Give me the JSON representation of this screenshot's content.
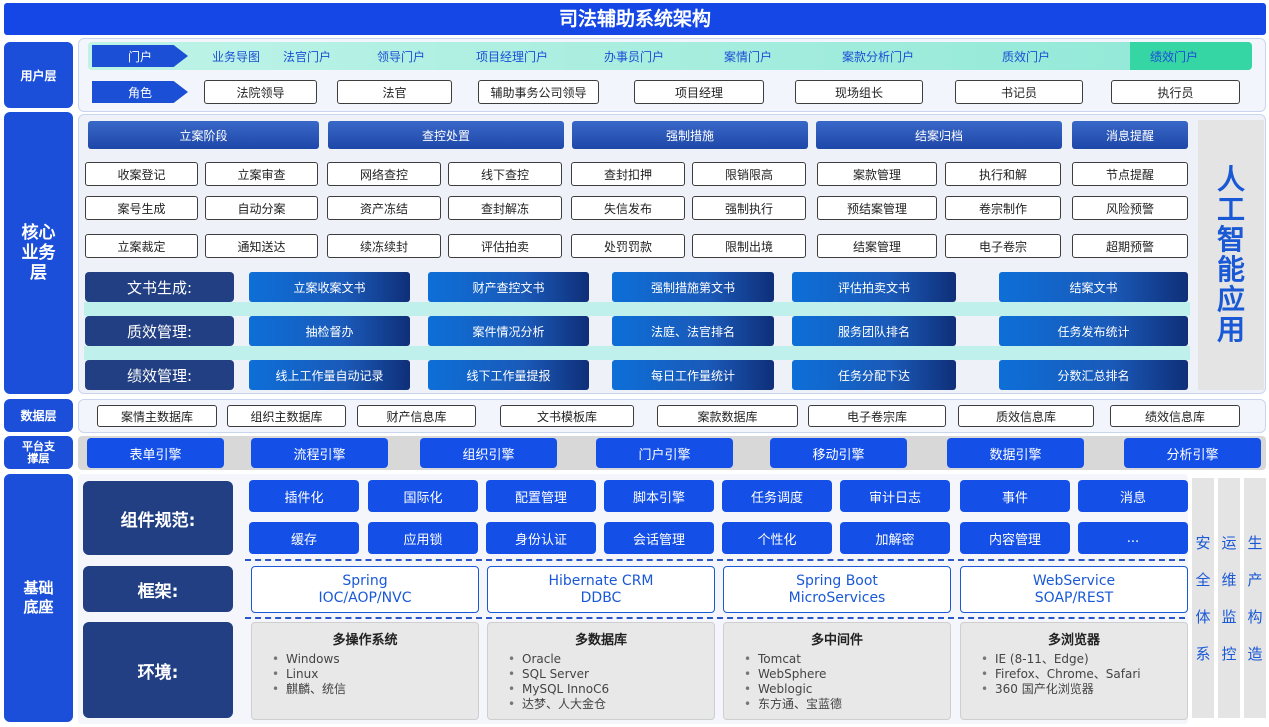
{
  "title": "司法辅助系统架构",
  "layers": {
    "user": "用户层",
    "core": "核心业务层",
    "data": "数据层",
    "platform": "平台支撑层",
    "base": "基础底座"
  },
  "portal": {
    "tag": "门户",
    "items": [
      "业务导图",
      "法官门户",
      "领导门户",
      "项目经理门户",
      "办事员门户",
      "案情门户",
      "案款分析门户",
      "质效门户",
      "绩效门户"
    ]
  },
  "roles": {
    "tag": "角色",
    "items": [
      "法院领导",
      "法官",
      "辅助事务公司领导",
      "项目经理",
      "现场组长",
      "书记员",
      "执行员"
    ]
  },
  "stages": [
    "立案阶段",
    "查控处置",
    "强制措施",
    "结案归档",
    "消息提醒"
  ],
  "business_rows": [
    [
      "收案登记",
      "立案审查",
      "网络查控",
      "线下查控",
      "查封扣押",
      "限销限高",
      "案款管理",
      "执行和解",
      "节点提醒"
    ],
    [
      "案号生成",
      "自动分案",
      "资产冻结",
      "查封解冻",
      "失信发布",
      "强制执行",
      "预结案管理",
      "卷宗制作",
      "风险预警"
    ],
    [
      "立案裁定",
      "通知送达",
      "续冻续封",
      "评估拍卖",
      "处罚罚款",
      "限制出境",
      "结案管理",
      "电子卷宗",
      "超期预警"
    ]
  ],
  "doc_gen": {
    "label": "文书生成:",
    "items": [
      "立案收案文书",
      "财产查控文书",
      "强制措施第文书",
      "评估拍卖文书",
      "结案文书"
    ]
  },
  "quality": {
    "label": "质效管理:",
    "items": [
      "抽检督办",
      "案件情况分析",
      "法庭、法官排名",
      "服务团队排名",
      "任务发布统计"
    ]
  },
  "performance": {
    "label": "绩效管理:",
    "items": [
      "线上工作量自动记录",
      "线下工作量提报",
      "每日工作量统计",
      "任务分配下达",
      "分数汇总排名"
    ]
  },
  "ai": [
    "人",
    "工",
    "智",
    "能",
    "应",
    "用"
  ],
  "data_items": [
    "案情主数据库",
    "组织主数据库",
    "财产信息库",
    "文书模板库",
    "案款数据库",
    "电子卷宗库",
    "质效信息库",
    "绩效信息库"
  ],
  "engines": [
    "表单引擎",
    "流程引擎",
    "组织引擎",
    "门户引擎",
    "移动引擎",
    "数据引擎",
    "分析引擎"
  ],
  "components": {
    "label": "组件规范:",
    "row1": [
      "插件化",
      "国际化",
      "配置管理",
      "脚本引擎",
      "任务调度",
      "审计日志",
      "事件",
      "消息"
    ],
    "row2": [
      "缓存",
      "应用锁",
      "身份认证",
      "会话管理",
      "个性化",
      "加解密",
      "内容管理",
      "..."
    ]
  },
  "framework": {
    "label": "框架:",
    "items": [
      {
        "l1": "Spring",
        "l2": "IOC/AOP/NVC"
      },
      {
        "l1": "Hibernate CRM",
        "l2": "DDBC"
      },
      {
        "l1": "Spring Boot",
        "l2": "MicroServices"
      },
      {
        "l1": "WebService",
        "l2": "SOAP/REST"
      }
    ]
  },
  "environment": {
    "label": "环境:",
    "boxes": [
      {
        "title": "多操作系统",
        "items": [
          "Windows",
          "Linux",
          "麒麟、统信"
        ]
      },
      {
        "title": "多数据库",
        "items": [
          "Oracle",
          "SQL Server",
          "MySQL InnoC6",
          "达梦、人大金仓"
        ]
      },
      {
        "title": "多中间件",
        "items": [
          "Tomcat",
          "WebSphere",
          "Weblogic",
          "东方通、宝蓝德"
        ]
      },
      {
        "title": "多浏览器",
        "items": [
          "IE (8-11、Edge)",
          "Firefox、Chrome、Safari",
          "360 国产化浏览器"
        ]
      }
    ]
  },
  "side_columns": [
    [
      "安",
      "全",
      "体",
      "系"
    ],
    [
      "运",
      "维",
      "监",
      "控"
    ],
    [
      "生",
      "产",
      "构",
      "造"
    ]
  ]
}
